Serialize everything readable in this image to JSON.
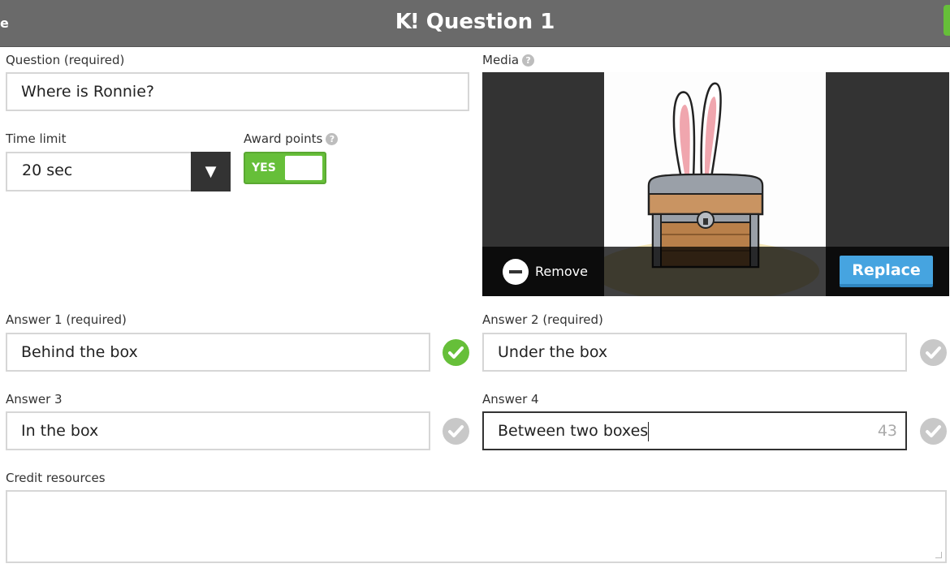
{
  "header": {
    "left_label": "e",
    "logo": "K!",
    "title": "Question 1"
  },
  "question": {
    "label": "Question (required)",
    "value": "Where is Ronnie?"
  },
  "time_limit": {
    "label": "Time limit",
    "value": "20 sec"
  },
  "award_points": {
    "label": "Award points",
    "toggle_label": "YES",
    "enabled": true
  },
  "media": {
    "label": "Media",
    "remove_label": "Remove",
    "replace_label": "Replace",
    "image_icon": "bunny-in-treasure-chest-image"
  },
  "answers": [
    {
      "label": "Answer 1 (required)",
      "value": "Behind the box",
      "correct": true
    },
    {
      "label": "Answer 2 (required)",
      "value": "Under the box",
      "correct": false
    },
    {
      "label": "Answer 3",
      "value": "In the box",
      "correct": false
    },
    {
      "label": "Answer 4",
      "value": "Between two boxes",
      "correct": false,
      "chars_left": "43"
    }
  ],
  "credit": {
    "label": "Credit resources",
    "value": ""
  },
  "colors": {
    "header": "#6a6a6a",
    "accent_green": "#66bf39",
    "replace_blue": "#46a4e0"
  }
}
